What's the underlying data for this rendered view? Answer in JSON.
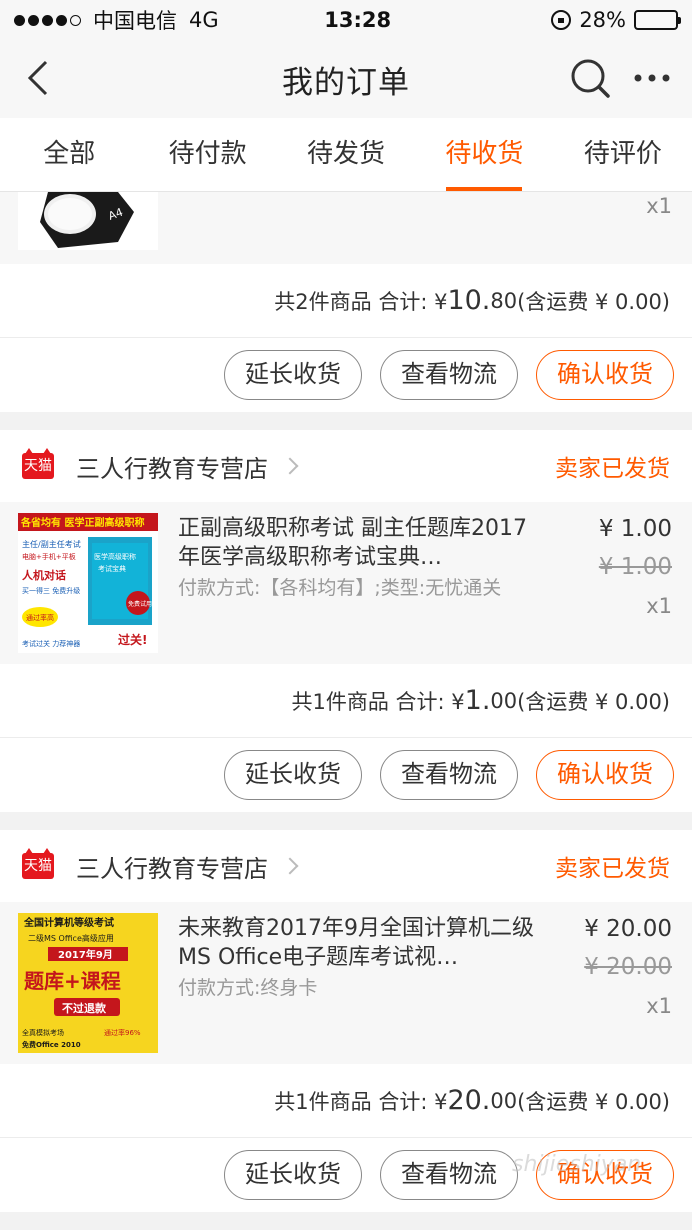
{
  "status_bar": {
    "carrier": "中国电信",
    "network": "4G",
    "time": "13:28",
    "battery": "28%",
    "battery_level": 0.28
  },
  "nav": {
    "title": "我的订单",
    "back_icon": "back-chevron-icon",
    "search_icon": "search-icon",
    "more_icon": "more-dots-icon"
  },
  "tabs": [
    {
      "label": "全部",
      "active": false
    },
    {
      "label": "待付款",
      "active": false
    },
    {
      "label": "待发货",
      "active": false
    },
    {
      "label": "待收货",
      "active": true
    },
    {
      "label": "待评价",
      "active": false
    }
  ],
  "colors": {
    "accent": "#ff5a00",
    "tmall_red": "#e4181e"
  },
  "orders": [
    {
      "partial": true,
      "qty": "x1",
      "summary": {
        "count": "共2件商品 合计: ¥",
        "big": "10.",
        "small": "80",
        "shipping": " (含运费 ¥ 0.00)"
      },
      "actions": [
        "延长收货",
        "查看物流",
        "确认收货"
      ]
    },
    {
      "shop_badge": "天猫",
      "shop_name": "三人行教育专营店",
      "status": "卖家已发货",
      "product": {
        "title": "正副高级职称考试 副主任题库2017年医学高级职称考试宝典…",
        "spec": "付款方式:【各科均有】;类型:无忧通关",
        "price": "¥ 1.00",
        "orig_price": "¥ 1.00",
        "qty": "x1",
        "thumb_banner": "各省均有 医学正副高级职称",
        "thumb_lines": [
          "主任/副主任考试",
          "电脑+手机+平板",
          "人机对话",
          "买一得三 免费升级",
          "通过率高",
          "考试过关 力荐神器",
          "过关!"
        ],
        "thumb_box": [
          "医学高级职称",
          "考试宝典",
          "免费试用"
        ]
      },
      "summary": {
        "count": "共1件商品 合计: ¥",
        "big": "1.",
        "small": "00",
        "shipping": " (含运费 ¥ 0.00)"
      },
      "actions": [
        "延长收货",
        "查看物流",
        "确认收货"
      ]
    },
    {
      "shop_badge": "天猫",
      "shop_name": "三人行教育专营店",
      "status": "卖家已发货",
      "product": {
        "title": "未来教育2017年9月全国计算机二级MS Office电子题库考试视…",
        "spec": "付款方式:终身卡",
        "price": "¥ 20.00",
        "orig_price": "¥ 20.00",
        "qty": "x1",
        "thumb_lines": [
          "全国计算机等级考试",
          "二级MS Office高级应用",
          "2017年9月",
          "题库+课程",
          "不过退款",
          "全真模拟考场",
          "免费Office 2010",
          "通过率96%"
        ]
      },
      "summary": {
        "count": "共1件商品 合计: ¥",
        "big": "20.",
        "small": "00",
        "shipping": " (含运费 ¥ 0.00)"
      },
      "actions": [
        "延长收货",
        "查看物流",
        "确认收货"
      ]
    }
  ],
  "watermark": "shijieshiyan"
}
